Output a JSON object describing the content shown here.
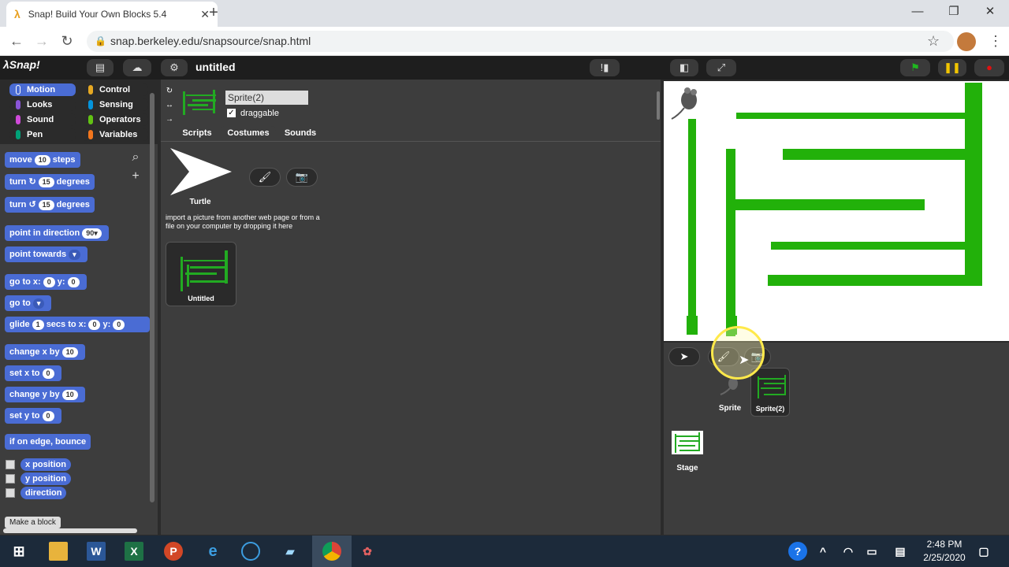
{
  "browser": {
    "tab_title": "Snap! Build Your Own Blocks 5.4",
    "url": "snap.berkeley.edu/snapsource/snap.html"
  },
  "snap": {
    "logo": "λSnap!",
    "project_title": "untitled"
  },
  "categories": [
    "Motion",
    "Looks",
    "Sound",
    "Pen",
    "Control",
    "Sensing",
    "Operators",
    "Variables"
  ],
  "blocks": {
    "move": "move",
    "move_val": "10",
    "move_suffix": "steps",
    "turn_cw": "turn ↻",
    "turn_cw_val": "15",
    "turn_cw_suffix": "degrees",
    "turn_ccw": "turn ↺",
    "turn_ccw_val": "15",
    "turn_ccw_suffix": "degrees",
    "point_dir": "point in direction",
    "point_dir_val": "90▾",
    "point_towards": "point towards",
    "goto_xy": "go to x:",
    "goto_x": "0",
    "goto_y_label": "y:",
    "goto_y": "0",
    "goto": "go to",
    "glide": "glide",
    "glide_val": "1",
    "glide_mid": "secs to x:",
    "glide_x": "0",
    "glide_y_label": "y:",
    "glide_y": "0",
    "change_x": "change x by",
    "change_x_val": "10",
    "set_x": "set x to",
    "set_x_val": "0",
    "change_y": "change y by",
    "change_y_val": "10",
    "set_y": "set y to",
    "set_y_val": "0",
    "bounce": "if on edge, bounce",
    "x_position": "x position",
    "y_position": "y position",
    "direction": "direction",
    "make_block": "Make a block"
  },
  "sprite": {
    "name": "Sprite(2)",
    "draggable_label": "draggable"
  },
  "tabs": [
    "Scripts",
    "Costumes",
    "Sounds"
  ],
  "costumes": {
    "turtle_label": "Turtle",
    "import_hint": "import a picture from another web page or from a file on your computer by dropping it here",
    "costume_label": "Untitled"
  },
  "corral": {
    "sprite1": "Sprite",
    "sprite2": "Sprite(2)",
    "stage": "Stage"
  },
  "taskbar": {
    "time": "2:48 PM",
    "date": "2/25/2020"
  }
}
